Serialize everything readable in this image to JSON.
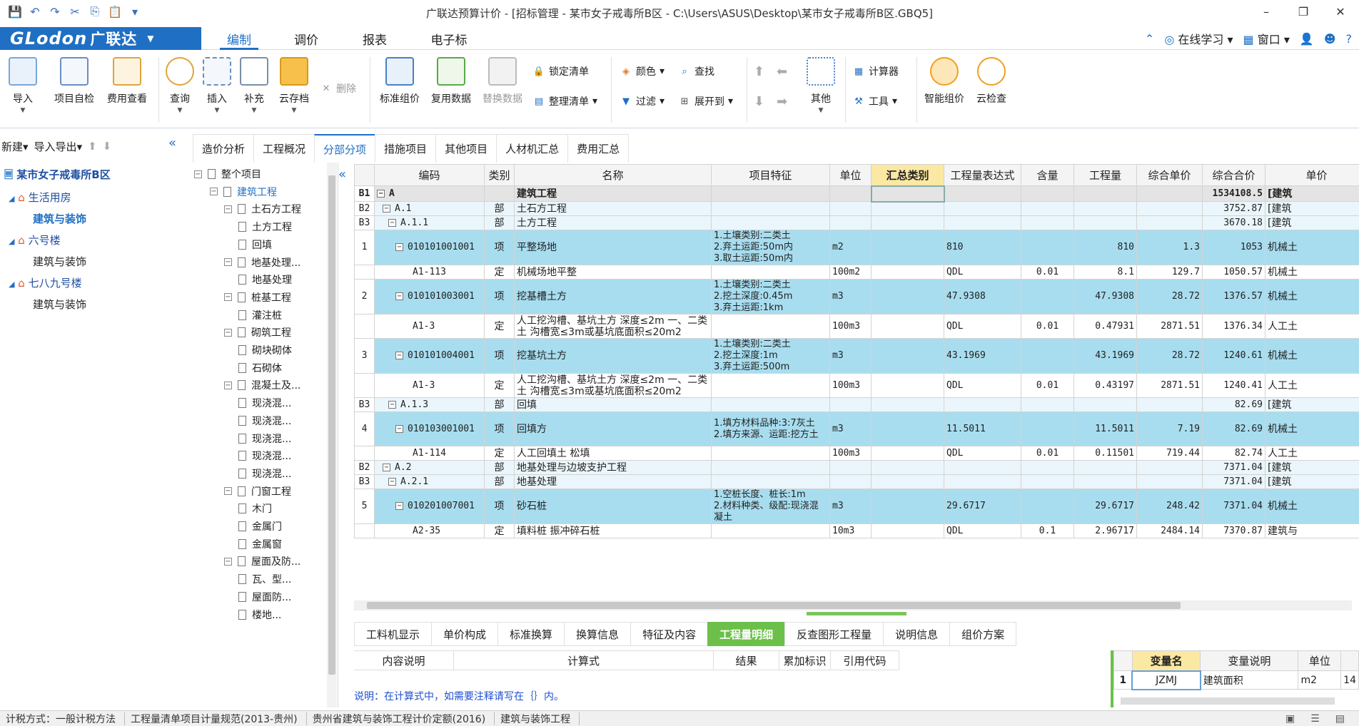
{
  "window": {
    "title": "广联达预算计价 - [招标管理 - 某市女子戒毒所B区 - C:\\Users\\ASUS\\Desktop\\某市女子戒毒所B区.GBQ5]",
    "minimize": "–",
    "restore": "❐",
    "close": "✕"
  },
  "brand": {
    "logo": "GLodon",
    "cn": "广联达",
    "caret": "▼"
  },
  "menu": {
    "tabs": [
      "编制",
      "调价",
      "报表",
      "电子标"
    ],
    "active": "编制",
    "right": {
      "online": "在线学习",
      "window": "窗口",
      "help": "?"
    }
  },
  "ribbon": {
    "import": "导入",
    "self_check": "项目自检",
    "fee_view": "费用查看",
    "query": "查询",
    "insert": "插入",
    "supplement": "补充",
    "cloud_save": "云存档",
    "delete": "删除",
    "std_group": "标准组价",
    "reuse_data": "复用数据",
    "replace_data": "替换数据",
    "lock_list": "锁定清单",
    "sort_list": "整理清单",
    "color": "颜色",
    "find": "查找",
    "filter": "过滤",
    "expand_to": "展开到",
    "other": "其他",
    "calculator": "计算器",
    "tools": "工具",
    "smart_group": "智能组价",
    "cloud_check": "云检查"
  },
  "left": {
    "new": "新建",
    "import_export": "导入导出",
    "root": "某市女子戒毒所B区",
    "tree": [
      {
        "label": "生活用房",
        "level": 1
      },
      {
        "label": "建筑与装饰",
        "level": 2,
        "selected": true
      },
      {
        "label": "六号楼",
        "level": 1
      },
      {
        "label": "建筑与装饰",
        "level": 2
      },
      {
        "label": "七八九号楼",
        "level": 1
      },
      {
        "label": "建筑与装饰",
        "level": 2
      }
    ]
  },
  "main_tabs": [
    "造价分析",
    "工程概况",
    "分部分项",
    "措施项目",
    "其他项目",
    "人材机汇总",
    "费用汇总"
  ],
  "main_tab_active": "分部分项",
  "treenav": [
    {
      "label": "整个项目",
      "level": 0,
      "pm": "−"
    },
    {
      "label": "建筑工程",
      "level": 1,
      "pm": "−",
      "link": true
    },
    {
      "label": "土石方工程",
      "level": 2,
      "pm": "−"
    },
    {
      "label": "土方工程",
      "level": 3
    },
    {
      "label": "回填",
      "level": 3
    },
    {
      "label": "地基处理...",
      "level": 2,
      "pm": "−"
    },
    {
      "label": "地基处理",
      "level": 3
    },
    {
      "label": "桩基工程",
      "level": 2,
      "pm": "−"
    },
    {
      "label": "灌注桩",
      "level": 3
    },
    {
      "label": "砌筑工程",
      "level": 2,
      "pm": "−"
    },
    {
      "label": "砌块砌体",
      "level": 3
    },
    {
      "label": "石砌体",
      "level": 3
    },
    {
      "label": "混凝土及...",
      "level": 2,
      "pm": "−"
    },
    {
      "label": "现浇混...",
      "level": 3
    },
    {
      "label": "现浇混...",
      "level": 3
    },
    {
      "label": "现浇混...",
      "level": 3
    },
    {
      "label": "现浇混...",
      "level": 3
    },
    {
      "label": "现浇混...",
      "level": 3
    },
    {
      "label": "门窗工程",
      "level": 2,
      "pm": "−"
    },
    {
      "label": "木门",
      "level": 3
    },
    {
      "label": "金属门",
      "level": 3
    },
    {
      "label": "金属窗",
      "level": 3
    },
    {
      "label": "屋面及防...",
      "level": 2,
      "pm": "−"
    },
    {
      "label": "瓦、型...",
      "level": 3
    },
    {
      "label": "屋面防...",
      "level": 3
    },
    {
      "label": "楼地...",
      "level": 3
    }
  ],
  "grid": {
    "columns": [
      "",
      "编码",
      "类别",
      "名称",
      "项目特征",
      "单位",
      "汇总类别",
      "工程量表达式",
      "含量",
      "工程量",
      "综合单价",
      "综合合价",
      "单价"
    ],
    "rows": [
      {
        "type": "top",
        "no": "B1",
        "code": "A",
        "cat": "",
        "name": "建筑工程",
        "feat": "",
        "unit": "",
        "sum": "",
        "expr": "",
        "content": "",
        "qty": "",
        "price": "",
        "total": "1534108.5",
        "ptype": "[建筑"
      },
      {
        "type": "fb",
        "no": "B2",
        "code": "A.1",
        "cat": "部",
        "name": "土石方工程",
        "feat": "",
        "unit": "",
        "sum": "",
        "expr": "",
        "content": "",
        "qty": "",
        "price": "",
        "total": "3752.87",
        "ptype": "[建筑"
      },
      {
        "type": "fb",
        "no": "B3",
        "code": "A.1.1",
        "cat": "部",
        "name": "土方工程",
        "feat": "",
        "unit": "",
        "sum": "",
        "expr": "",
        "content": "",
        "qty": "",
        "price": "",
        "total": "3670.18",
        "ptype": "[建筑"
      },
      {
        "type": "qd",
        "no": "1",
        "code": "010101001001",
        "cat": "项",
        "name": "平整场地",
        "feat": "1.土壤类别:二类土\n2.弃土运距:50m内\n3.取土运距:50m内",
        "unit": "m2",
        "sum": "",
        "expr": "810",
        "content": "",
        "qty": "810",
        "price": "1.3",
        "total": "1053",
        "ptype": "机械土"
      },
      {
        "type": "de",
        "no": "",
        "code": "A1-113",
        "cat": "定",
        "name": "机械场地平整",
        "feat": "",
        "unit": "100m2",
        "sum": "",
        "expr": "QDL",
        "content": "0.01",
        "qty": "8.1",
        "price": "129.7",
        "total": "1050.57",
        "ptype": "机械土"
      },
      {
        "type": "qd",
        "no": "2",
        "code": "010101003001",
        "cat": "项",
        "name": "挖基槽土方",
        "feat": "1.土壤类别:二类土\n2.挖土深度:0.45m\n3.弃土运距:1km",
        "unit": "m3",
        "sum": "",
        "expr": "47.9308",
        "content": "",
        "qty": "47.9308",
        "price": "28.72",
        "total": "1376.57",
        "ptype": "机械土"
      },
      {
        "type": "de",
        "no": "",
        "code": "A1-3",
        "cat": "定",
        "name": "人工挖沟槽、基坑土方 深度≤2m 一、二类土 沟槽宽≤3m或基坑底面积≤20m2",
        "feat": "",
        "unit": "100m3",
        "sum": "",
        "expr": "QDL",
        "content": "0.01",
        "qty": "0.47931",
        "price": "2871.51",
        "total": "1376.34",
        "ptype": "人工土"
      },
      {
        "type": "qd",
        "no": "3",
        "code": "010101004001",
        "cat": "项",
        "name": "挖基坑土方",
        "feat": "1.土壤类别:二类土\n2.挖土深度:1m\n3.弃土运距:500m",
        "unit": "m3",
        "sum": "",
        "expr": "43.1969",
        "content": "",
        "qty": "43.1969",
        "price": "28.72",
        "total": "1240.61",
        "ptype": "机械土"
      },
      {
        "type": "de",
        "no": "",
        "code": "A1-3",
        "cat": "定",
        "name": "人工挖沟槽、基坑土方 深度≤2m 一、二类土 沟槽宽≤3m或基坑底面积≤20m2",
        "feat": "",
        "unit": "100m3",
        "sum": "",
        "expr": "QDL",
        "content": "0.01",
        "qty": "0.43197",
        "price": "2871.51",
        "total": "1240.41",
        "ptype": "人工土"
      },
      {
        "type": "fb",
        "no": "B3",
        "code": "A.1.3",
        "cat": "部",
        "name": "回填",
        "feat": "",
        "unit": "",
        "sum": "",
        "expr": "",
        "content": "",
        "qty": "",
        "price": "",
        "total": "82.69",
        "ptype": "[建筑"
      },
      {
        "type": "qd",
        "no": "4",
        "code": "010103001001",
        "cat": "项",
        "name": "回填方",
        "feat": "1.填方材料品种:3:7灰土\n2.填方来源、运距:挖方土",
        "unit": "m3",
        "sum": "",
        "expr": "11.5011",
        "content": "",
        "qty": "11.5011",
        "price": "7.19",
        "total": "82.69",
        "ptype": "机械土"
      },
      {
        "type": "de",
        "no": "",
        "code": "A1-114",
        "cat": "定",
        "name": "人工回填土 松填",
        "feat": "",
        "unit": "100m3",
        "sum": "",
        "expr": "QDL",
        "content": "0.01",
        "qty": "0.11501",
        "price": "719.44",
        "total": "82.74",
        "ptype": "人工土"
      },
      {
        "type": "fb",
        "no": "B2",
        "code": "A.2",
        "cat": "部",
        "name": "地基处理与边坡支护工程",
        "feat": "",
        "unit": "",
        "sum": "",
        "expr": "",
        "content": "",
        "qty": "",
        "price": "",
        "total": "7371.04",
        "ptype": "[建筑"
      },
      {
        "type": "fb",
        "no": "B3",
        "code": "A.2.1",
        "cat": "部",
        "name": "地基处理",
        "feat": "",
        "unit": "",
        "sum": "",
        "expr": "",
        "content": "",
        "qty": "",
        "price": "",
        "total": "7371.04",
        "ptype": "[建筑"
      },
      {
        "type": "qd",
        "no": "5",
        "code": "010201007001",
        "cat": "项",
        "name": "砂石桩",
        "feat": "1.空桩长度、桩长:1m\n2.材料种类、级配:现浇混凝土",
        "unit": "m3",
        "sum": "",
        "expr": "29.6717",
        "content": "",
        "qty": "29.6717",
        "price": "248.42",
        "total": "7371.04",
        "ptype": "机械土"
      },
      {
        "type": "de",
        "no": "",
        "code": "A2-35",
        "cat": "定",
        "name": "填料桩 振冲碎石桩",
        "feat": "",
        "unit": "10m3",
        "sum": "",
        "expr": "QDL",
        "content": "0.1",
        "qty": "2.96717",
        "price": "2484.14",
        "total": "7370.87",
        "ptype": "建筑与"
      }
    ]
  },
  "bottom_tabs": [
    "工料机显示",
    "单价构成",
    "标准换算",
    "换算信息",
    "特征及内容",
    "工程量明细",
    "反查图形工程量",
    "说明信息",
    "组价方案"
  ],
  "bottom_tab_active": "工程量明细",
  "formula_cols": [
    "内容说明",
    "计算式",
    "结果",
    "累加标识",
    "引用代码"
  ],
  "note": "说明：在计算式中，如需要注释请写在｛｝内。",
  "vars": {
    "columns": [
      "",
      "变量名",
      "变量说明",
      "单位",
      ""
    ],
    "rows": [
      {
        "no": "1",
        "name": "JZMJ",
        "desc": "建筑面积",
        "unit": "m2",
        "value": "14"
      }
    ]
  },
  "status": [
    "计税方式：一般计税方法",
    "工程量清单项目计量规范(2013-贵州)",
    "贵州省建筑与装饰工程计价定额(2016)",
    "建筑与装饰工程"
  ],
  "colors": {
    "brand": "#1f6fc4",
    "list_row": "#a8ddef",
    "fb_row": "#eaf6fb",
    "active_green": "#6cc04a",
    "highlight": "#fbe8a3"
  }
}
